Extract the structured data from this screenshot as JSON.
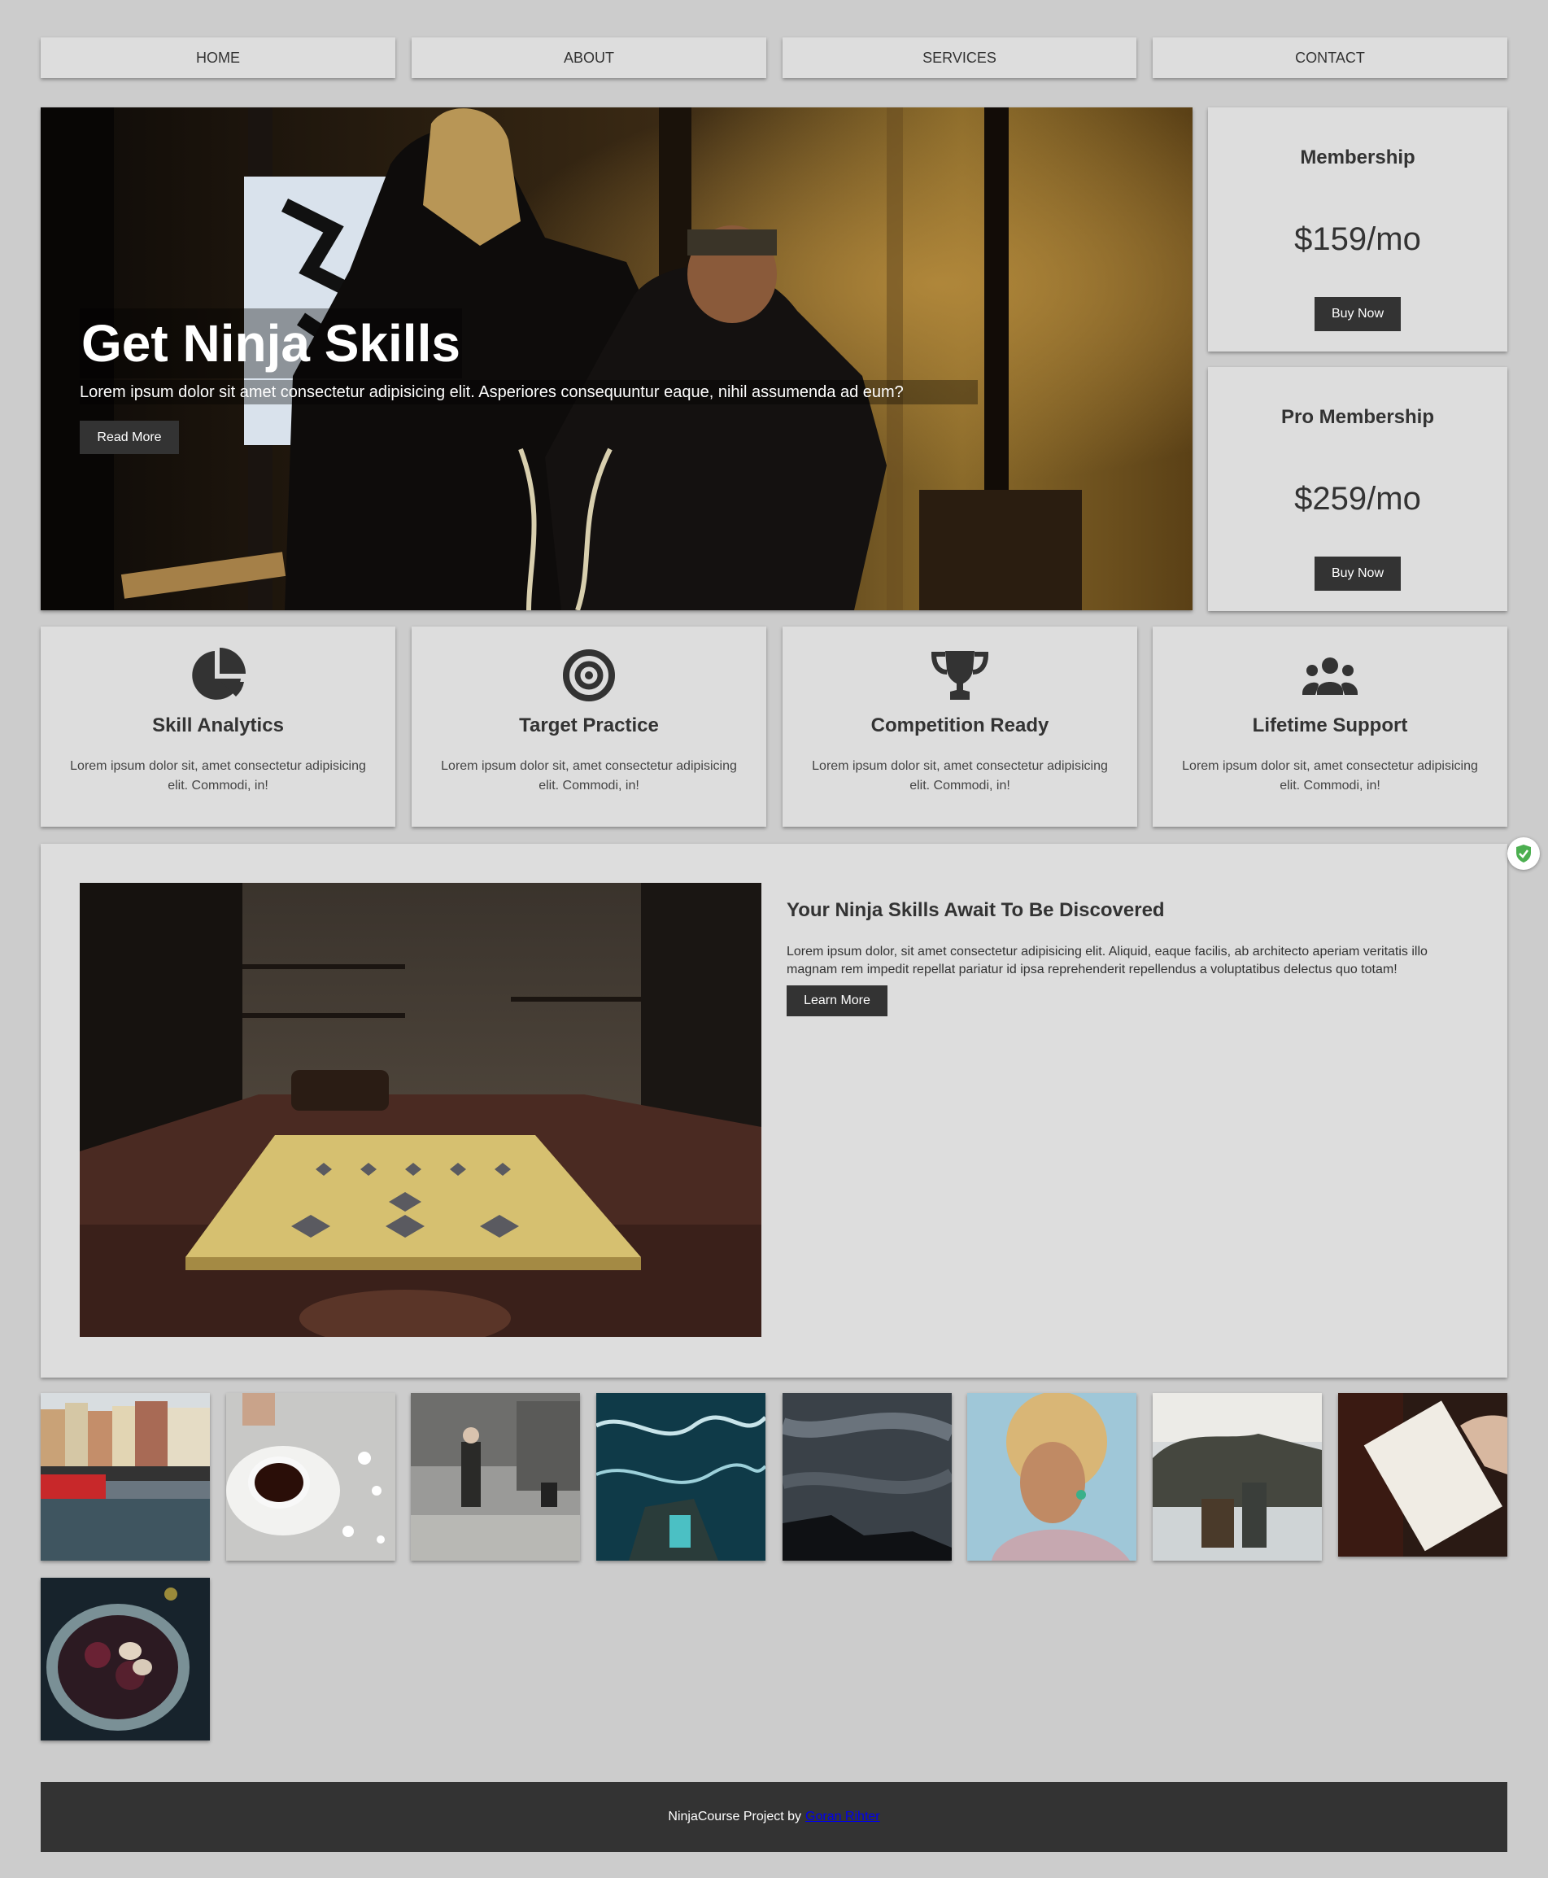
{
  "nav": {
    "items": [
      {
        "label": "HOME"
      },
      {
        "label": "ABOUT"
      },
      {
        "label": "SERVICES"
      },
      {
        "label": "CONTACT"
      }
    ]
  },
  "hero": {
    "title": "Get Ninja Skills",
    "text": "Lorem ipsum dolor sit amet consectetur adipisicing elit. Asperiores consequuntur eaque, nihil assumenda ad eum?",
    "button": "Read More"
  },
  "pricing": [
    {
      "title": "Membership",
      "price": "$159/mo",
      "button": "Buy Now"
    },
    {
      "title": "Pro Membership",
      "price": "$259/mo",
      "button": "Buy Now"
    }
  ],
  "features": [
    {
      "icon": "pie-chart-icon",
      "title": "Skill Analytics",
      "text": "Lorem ipsum dolor sit, amet consectetur adipisicing elit. Commodi, in!"
    },
    {
      "icon": "target-icon",
      "title": "Target Practice",
      "text": "Lorem ipsum dolor sit, amet consectetur adipisicing elit. Commodi, in!"
    },
    {
      "icon": "trophy-icon",
      "title": "Competition Ready",
      "text": "Lorem ipsum dolor sit, amet consectetur adipisicing elit. Commodi, in!"
    },
    {
      "icon": "users-icon",
      "title": "Lifetime Support",
      "text": "Lorem ipsum dolor sit, amet consectetur adipisicing elit. Commodi, in!"
    }
  ],
  "about": {
    "title": "Your Ninja Skills Await To Be Discovered",
    "text": "Lorem ipsum dolor, sit amet consectetur adipisicing elit. Aliquid, eaque facilis, ab architecto aperiam veritatis illo magnam rem impedit repellat pariatur id ipsa reprehenderit repellendus a voluptatibus delectus quo totam!",
    "button": "Learn More"
  },
  "footer": {
    "text": "NinjaCourse Project by",
    "link": "Goran Rihter"
  },
  "colors": {
    "background": "#cccccc",
    "card": "#dddddd",
    "dark": "#333333",
    "link": "#0000ee",
    "shield": "#4caf50"
  }
}
